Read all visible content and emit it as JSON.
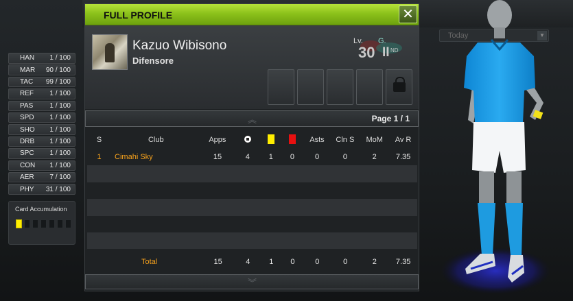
{
  "background": {
    "dropdown_value": "Today"
  },
  "stats": [
    {
      "key": "HAN",
      "value": "1 / 100"
    },
    {
      "key": "MAR",
      "value": "90 / 100"
    },
    {
      "key": "TAC",
      "value": "99 / 100"
    },
    {
      "key": "REF",
      "value": "1 / 100"
    },
    {
      "key": "PAS",
      "value": "1 / 100"
    },
    {
      "key": "SPD",
      "value": "1 / 100"
    },
    {
      "key": "SHO",
      "value": "1 / 100"
    },
    {
      "key": "DRB",
      "value": "1 / 100"
    },
    {
      "key": "SPC",
      "value": "1 / 100"
    },
    {
      "key": "CON",
      "value": "1 / 100"
    },
    {
      "key": "AER",
      "value": "7 / 100"
    },
    {
      "key": "PHY",
      "value": "31 / 100"
    }
  ],
  "card_accumulation": {
    "label": "Card Accumulation",
    "yellow_count": 1,
    "slots": 7
  },
  "panel": {
    "title": "FULL PROFILE",
    "close_label": "✕",
    "player": {
      "name": "Kazuo Wibisono",
      "position": "Difensore",
      "level_label": "Lv.",
      "level": "30",
      "grade_label": "G.",
      "grade": "II",
      "grade_suffix": "ND"
    },
    "pager": {
      "text": "Page 1 / 1"
    },
    "table": {
      "headers": {
        "s": "S",
        "club": "Club",
        "apps": "Apps",
        "asts": "Asts",
        "cln": "Cln S",
        "mom": "MoM",
        "avr": "Av R"
      },
      "rows": [
        {
          "s": "1",
          "club": "Cimahi Sky",
          "apps": "15",
          "goals": "4",
          "yellow": "1",
          "red": "0",
          "asts": "0",
          "cln": "0",
          "mom": "2",
          "avr": "7.35"
        }
      ],
      "total": {
        "label": "Total",
        "apps": "15",
        "goals": "4",
        "yellow": "1",
        "red": "0",
        "asts": "0",
        "cln": "0",
        "mom": "2",
        "avr": "7.35"
      }
    }
  },
  "colors": {
    "title_bar": "#8cc21b",
    "accent_orange": "#f7a21c",
    "kit_blue": "#1e9be0",
    "yellow_card": "#ffee00",
    "red_card": "#e81010"
  }
}
